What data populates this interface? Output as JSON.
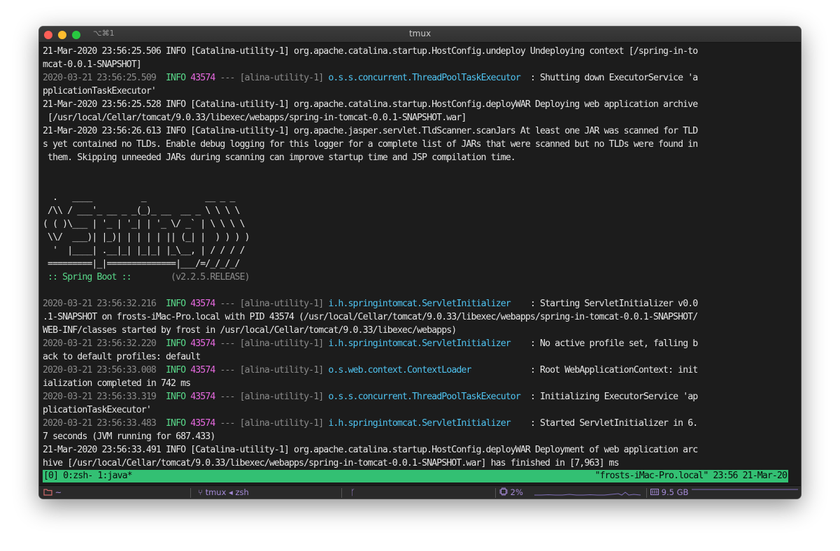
{
  "window": {
    "shortcut": "⌥⌘1",
    "title": "tmux"
  },
  "log": [
    [
      {
        "t": "21-Mar-2020 23:56:25.506 INFO [Catalina-utility-1] org.apache.catalina.startup.HostConfig.undeploy Undeploying context [/spring-in-to"
      }
    ],
    [
      {
        "t": "mcat-0.0.1-SNAPSHOT]"
      }
    ],
    [
      {
        "t": "2020-03-21 23:56:25.509  ",
        "c": "gray"
      },
      {
        "t": "INFO",
        "c": "green"
      },
      {
        "t": " "
      },
      {
        "t": "43574",
        "c": "magenta"
      },
      {
        "t": " --- [alina-utility-1] ",
        "c": "gray"
      },
      {
        "t": "o.s.s.concurrent.ThreadPoolTaskExecutor",
        "c": "cyan"
      },
      {
        "t": "  : Shutting down ExecutorService 'a"
      }
    ],
    [
      {
        "t": "pplicationTaskExecutor'"
      }
    ],
    [
      {
        "t": "21-Mar-2020 23:56:25.528 INFO [Catalina-utility-1] org.apache.catalina.startup.HostConfig.deployWAR Deploying web application archive"
      }
    ],
    [
      {
        "t": " [/usr/local/Cellar/tomcat/9.0.33/libexec/webapps/spring-in-tomcat-0.0.1-SNAPSHOT.war]"
      }
    ],
    [
      {
        "t": "21-Mar-2020 23:56:26.613 INFO [Catalina-utility-1] org.apache.jasper.servlet.TldScanner.scanJars At least one JAR was scanned for TLD"
      }
    ],
    [
      {
        "t": "s yet contained no TLDs. Enable debug logging for this logger for a complete list of JARs that were scanned but no TLDs were found in"
      }
    ],
    [
      {
        "t": " them. Skipping unneeded JARs during scanning can improve startup time and JSP compilation time."
      }
    ],
    [
      {
        "t": ""
      }
    ],
    [
      {
        "t": ""
      }
    ],
    [
      {
        "t": "  .   ____          _            __ _ _"
      }
    ],
    [
      {
        "t": " /\\\\ / ___'_ __ _ _(_)_ __  __ _ \\ \\ \\ \\"
      }
    ],
    [
      {
        "t": "( ( )\\___ | '_ | '_| | '_ \\/ _` | \\ \\ \\ \\"
      }
    ],
    [
      {
        "t": " \\\\/  ___)| |_)| | | | | || (_| |  ) ) ) )"
      }
    ],
    [
      {
        "t": "  '  |____| .__|_| |_|_| |_\\__, | / / / /"
      }
    ],
    [
      {
        "t": " =========|_|==============|___/=/_/_/_/"
      }
    ],
    [
      {
        "t": " :: Spring Boot :: ",
        "c": "green"
      },
      {
        "t": "       (v2.2.5.RELEASE)",
        "c": "gray"
      }
    ],
    [
      {
        "t": ""
      }
    ],
    [
      {
        "t": "2020-03-21 23:56:32.216  ",
        "c": "gray"
      },
      {
        "t": "INFO",
        "c": "green"
      },
      {
        "t": " "
      },
      {
        "t": "43574",
        "c": "magenta"
      },
      {
        "t": " --- [alina-utility-1] ",
        "c": "gray"
      },
      {
        "t": "i.h.springintomcat.ServletInitializer",
        "c": "cyan"
      },
      {
        "t": "    : Starting ServletInitializer v0.0"
      }
    ],
    [
      {
        "t": ".1-SNAPSHOT on frosts-iMac-Pro.local with PID 43574 (/usr/local/Cellar/tomcat/9.0.33/libexec/webapps/spring-in-tomcat-0.0.1-SNAPSHOT/"
      }
    ],
    [
      {
        "t": "WEB-INF/classes started by frost in /usr/local/Cellar/tomcat/9.0.33/libexec/webapps)"
      }
    ],
    [
      {
        "t": "2020-03-21 23:56:32.220  ",
        "c": "gray"
      },
      {
        "t": "INFO",
        "c": "green"
      },
      {
        "t": " "
      },
      {
        "t": "43574",
        "c": "magenta"
      },
      {
        "t": " --- [alina-utility-1] ",
        "c": "gray"
      },
      {
        "t": "i.h.springintomcat.ServletInitializer",
        "c": "cyan"
      },
      {
        "t": "    : No active profile set, falling b"
      }
    ],
    [
      {
        "t": "ack to default profiles: default"
      }
    ],
    [
      {
        "t": "2020-03-21 23:56:33.008  ",
        "c": "gray"
      },
      {
        "t": "INFO",
        "c": "green"
      },
      {
        "t": " "
      },
      {
        "t": "43574",
        "c": "magenta"
      },
      {
        "t": " --- [alina-utility-1] ",
        "c": "gray"
      },
      {
        "t": "o.s.web.context.ContextLoader",
        "c": "cyan"
      },
      {
        "t": "            : Root WebApplicationContext: init"
      }
    ],
    [
      {
        "t": "ialization completed in 742 ms"
      }
    ],
    [
      {
        "t": "2020-03-21 23:56:33.319  ",
        "c": "gray"
      },
      {
        "t": "INFO",
        "c": "green"
      },
      {
        "t": " "
      },
      {
        "t": "43574",
        "c": "magenta"
      },
      {
        "t": " --- [alina-utility-1] ",
        "c": "gray"
      },
      {
        "t": "o.s.s.concurrent.ThreadPoolTaskExecutor",
        "c": "cyan"
      },
      {
        "t": "  : Initializing ExecutorService 'ap"
      }
    ],
    [
      {
        "t": "plicationTaskExecutor'"
      }
    ],
    [
      {
        "t": "2020-03-21 23:56:33.483  ",
        "c": "gray"
      },
      {
        "t": "INFO",
        "c": "green"
      },
      {
        "t": " "
      },
      {
        "t": "43574",
        "c": "magenta"
      },
      {
        "t": " --- [alina-utility-1] ",
        "c": "gray"
      },
      {
        "t": "i.h.springintomcat.ServletInitializer",
        "c": "cyan"
      },
      {
        "t": "    : Started ServletInitializer in 6."
      }
    ],
    [
      {
        "t": "7 seconds (JVM running for 687.433)"
      }
    ],
    [
      {
        "t": "21-Mar-2020 23:56:33.491 INFO [Catalina-utility-1] org.apache.catalina.startup.HostConfig.deployWAR Deployment of web application arc"
      }
    ],
    [
      {
        "t": "hive [/usr/local/Cellar/tomcat/9.0.33/libexec/webapps/spring-in-tomcat-0.0.1-SNAPSHOT.war] has finished in [7,963] ms"
      }
    ]
  ],
  "status": {
    "left": "[0] 0:zsh- 1:java*",
    "right": "\"frosts-iMac-Pro.local\" 23:56 21-Mar-20"
  },
  "bottom": {
    "cwd": "~",
    "session": "tmux ◂ zsh",
    "cpu": "2%",
    "mem": "9.5 GB"
  },
  "colors": {
    "status_bg": "#33c073",
    "info": "#59d98a",
    "pid": "#e76ae0",
    "logger": "#4fc3f0",
    "timestamp": "#8a8a8a",
    "bottom_text": "#a58ad8"
  }
}
